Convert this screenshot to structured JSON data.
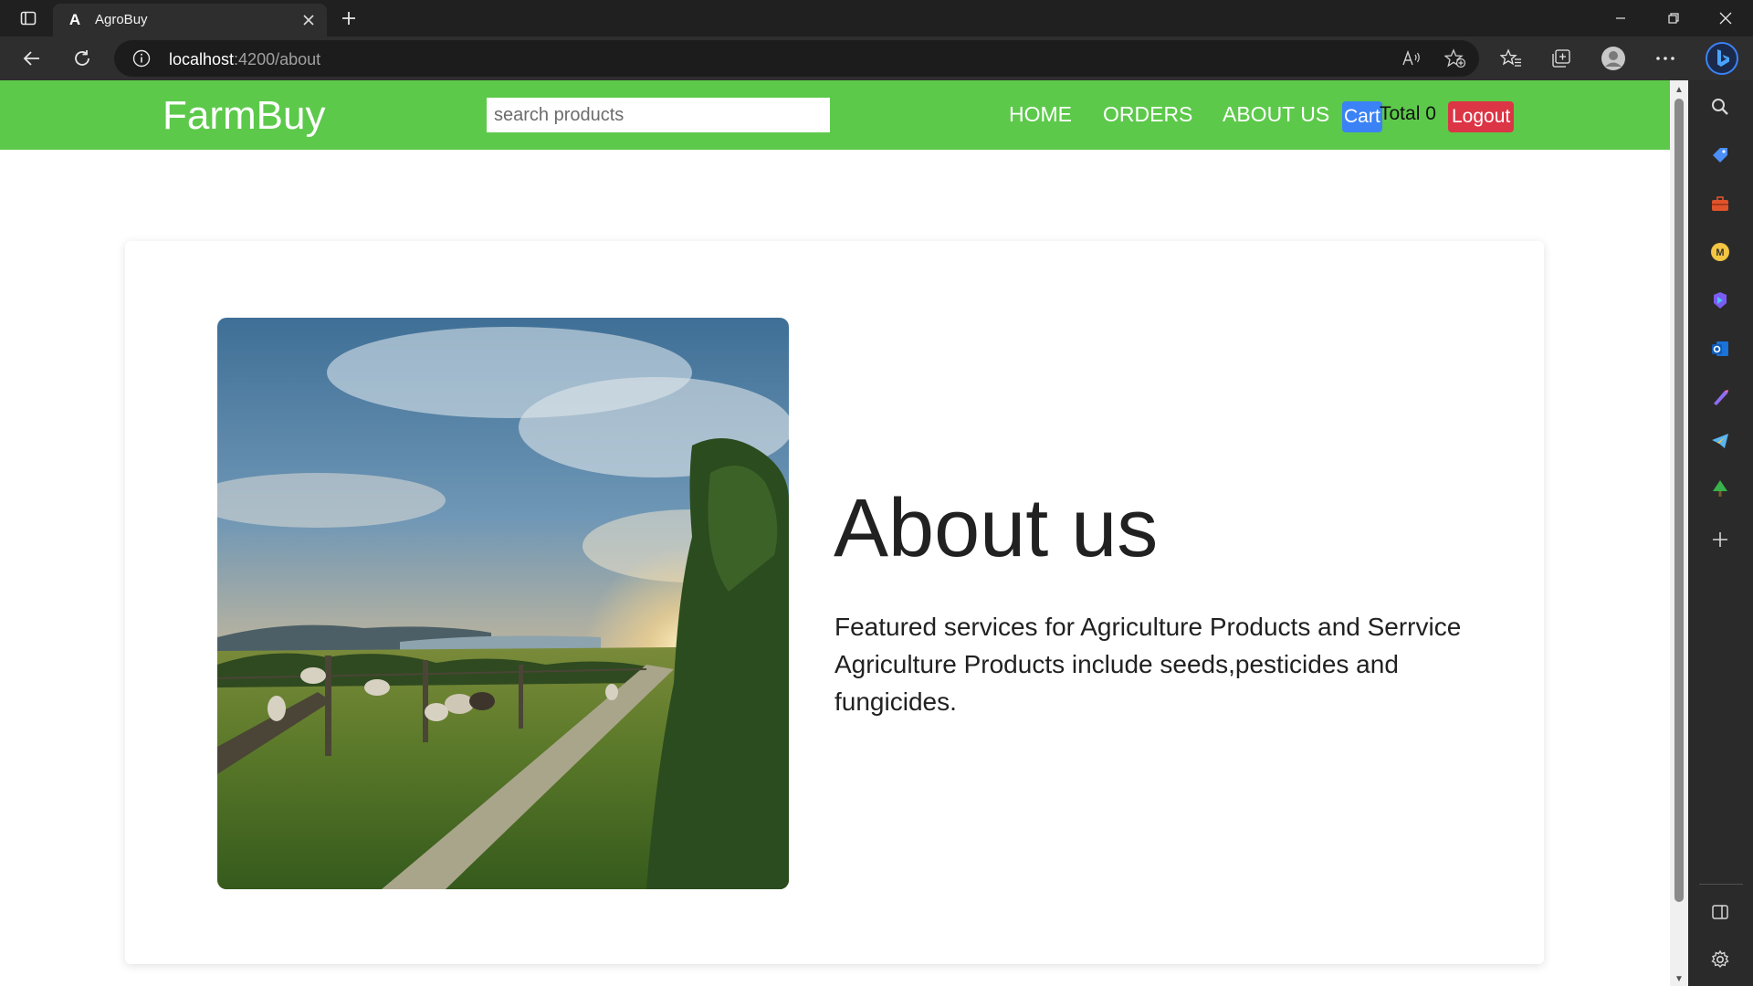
{
  "browser": {
    "tab": {
      "title": "AgroBuy",
      "favicon": "A"
    },
    "address": {
      "host": "localhost",
      "path": ":4200/about"
    }
  },
  "navbar": {
    "brand": "FarmBuy",
    "search_placeholder": "search products",
    "links": [
      "HOME",
      "ORDERS",
      "ABOUT US"
    ],
    "cart_label": "Cart",
    "cart_total": "Total 0",
    "logout_label": "Logout",
    "colors": {
      "navbar": "#5cc94a",
      "cart": "#3b82f6",
      "logout": "#dc3545"
    }
  },
  "about": {
    "title": "About us",
    "text": "Featured services for Agriculture Products and Serrvice Agriculture Products include seeds,pesticides and fungicides.",
    "image": "farm-landscape-with-sheep-at-sunset"
  },
  "sidebar_icons": [
    "search-icon",
    "tag-icon",
    "toolbox-icon",
    "m365-icon",
    "copilot-icon",
    "outlook-icon",
    "designer-icon",
    "telegram-icon",
    "tree-icon",
    "add-icon",
    "split-screen-icon",
    "settings-icon"
  ]
}
